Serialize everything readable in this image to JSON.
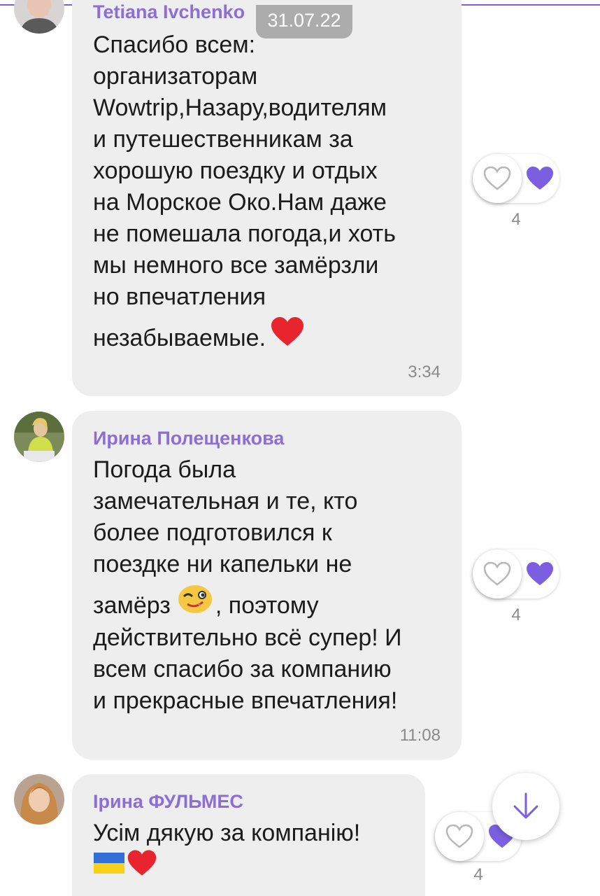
{
  "date_pill": "31.07.22",
  "messages": [
    {
      "sender": "Tetiana Ivchenko",
      "lines": [
        "Спасибо всем:",
        "организаторам",
        "Wowtrip,Назару,водителям",
        "и путешественникам за",
        "хорошую поездку и отдых",
        "на Морское Око.Нам даже",
        "не помешала погода,и хоть",
        "мы немного все замёрзли",
        "но впечатления",
        "незабываемые."
      ],
      "time": "3:34",
      "reaction_count": "4"
    },
    {
      "sender": "Ирина Полещенкова",
      "lines": [
        "Погода была",
        "замечательная и те, кто",
        "более подготовился к",
        "поездке ни капельки не",
        "замёрз",
        ", поэтому",
        "действительно всё супер! И",
        "всем спасибо за компанию",
        "и прекрасные впечатления!"
      ],
      "time": "11:08",
      "reaction_count": "4"
    },
    {
      "sender": "Ірина ФУЛЬМЕС",
      "lines": [
        "Усім дякую за компанію!"
      ],
      "reaction_count": "4"
    }
  ],
  "icons": {
    "like": "heart-outline-icon",
    "liked": "heart-filled-icon",
    "scroll": "arrow-down-icon"
  },
  "colors": {
    "accent": "#7b5fe0",
    "sender_name": "#8b6fd6",
    "bubble": "#efeeef",
    "heart_red": "#e8242f"
  }
}
